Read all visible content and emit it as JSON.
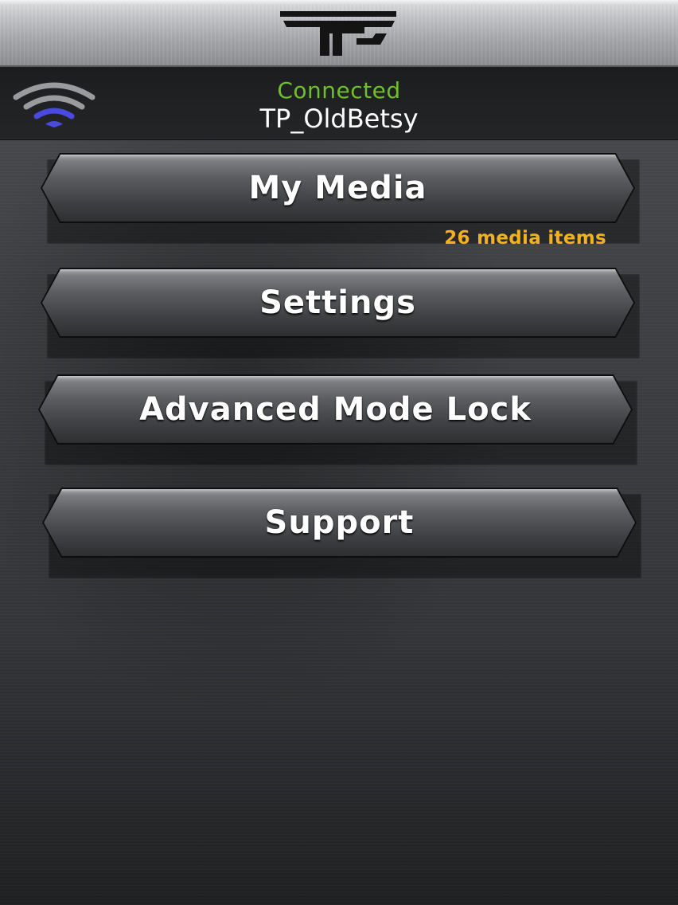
{
  "header": {
    "logo_name": "tp-logo"
  },
  "status": {
    "wifi_icon": "wifi-signal-icon",
    "connection_text": "Connected",
    "connection_color": "#6fc02c",
    "network_name": "TP_OldBetsy"
  },
  "menu": {
    "items": [
      {
        "label": "My Media"
      },
      {
        "label": "Settings"
      },
      {
        "label": "Advanced Mode Lock"
      },
      {
        "label": "Support"
      }
    ],
    "media_count": "26 media items",
    "media_count_color": "#f2b21d"
  }
}
